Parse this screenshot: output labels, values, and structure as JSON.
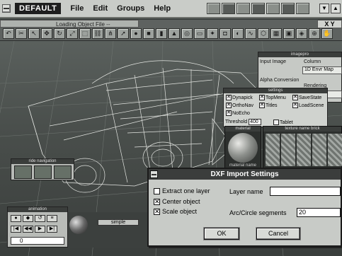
{
  "app": {
    "name": "DEFAULT"
  },
  "menu": {
    "items": [
      "File",
      "Edit",
      "Groups",
      "Help"
    ]
  },
  "status": {
    "loading_text": "Loading Object File --"
  },
  "view_label": "X Y",
  "imagepro": {
    "title": "imagepro",
    "input_label": "Input Image",
    "column_label": "Column",
    "column_value": "1D Envr Map",
    "alpha_label": "Alpha Conversion",
    "rendering_label": "Rendering",
    "rendering_value": "Color Map"
  },
  "settings": {
    "title": "settings",
    "options": [
      {
        "label": "Dynapick",
        "checked": true
      },
      {
        "label": "TopMenu",
        "checked": true
      },
      {
        "label": "SaveState",
        "checked": true
      },
      {
        "label": "OrthoNav",
        "checked": true
      },
      {
        "label": "Titles",
        "checked": true
      },
      {
        "label": "LoadScene",
        "checked": true
      },
      {
        "label": "NoEcho",
        "checked": true
      },
      {
        "label": "Tablet",
        "checked": false
      }
    ],
    "threshold_label": "Threshold",
    "threshold_value": "400"
  },
  "material": {
    "title": "material",
    "caption": "material name"
  },
  "texture": {
    "title": "texture name brick"
  },
  "ride_nav": {
    "title": "ride navigation"
  },
  "animation": {
    "title": "animation",
    "frame_value": "0"
  },
  "materials_bar": {
    "label": "simple"
  },
  "dialog": {
    "title": "DXF Import Settings",
    "extract_label": "Extract one layer",
    "extract_checked": false,
    "center_label": "Center object",
    "center_checked": true,
    "scale_label": "Scale object",
    "scale_checked": true,
    "layer_name_label": "Layer name",
    "layer_name_value": "",
    "arc_label": "Arc/Circle segments",
    "arc_value": "20",
    "ok_label": "OK",
    "cancel_label": "Cancel"
  },
  "colors": {
    "titlebar": "#3b3d3c",
    "dialog_bg": "#c8cbc7",
    "viewport": "#4a4f4c"
  }
}
